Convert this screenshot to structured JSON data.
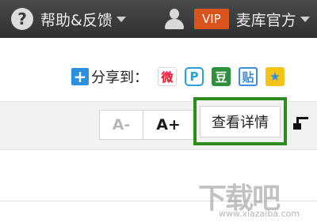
{
  "header": {
    "help": {
      "icon": "question-circle-icon",
      "label": "帮助&反馈"
    },
    "user": {
      "icon": "user-icon",
      "vip_badge": "VIP",
      "account_label": "麦库官方"
    }
  },
  "share": {
    "plus_icon": "+",
    "label": "分享到：",
    "targets": [
      {
        "name": "weibo",
        "glyph": "微"
      },
      {
        "name": "qq",
        "glyph": "P"
      },
      {
        "name": "douban",
        "glyph": "豆"
      },
      {
        "name": "tieba",
        "glyph": "贴"
      },
      {
        "name": "qzone",
        "glyph": "★"
      }
    ]
  },
  "toolbar": {
    "font_smaller": "A-",
    "font_larger": "A+",
    "view_details": "查看详情"
  },
  "watermark": {
    "text": "下载吧",
    "url": "www.xiazaiba.com"
  },
  "colors": {
    "topbar": "#3a3a3a",
    "vip": "#d9541d",
    "highlight": "#2e8b1e",
    "share_plus": "#2e8fde"
  }
}
